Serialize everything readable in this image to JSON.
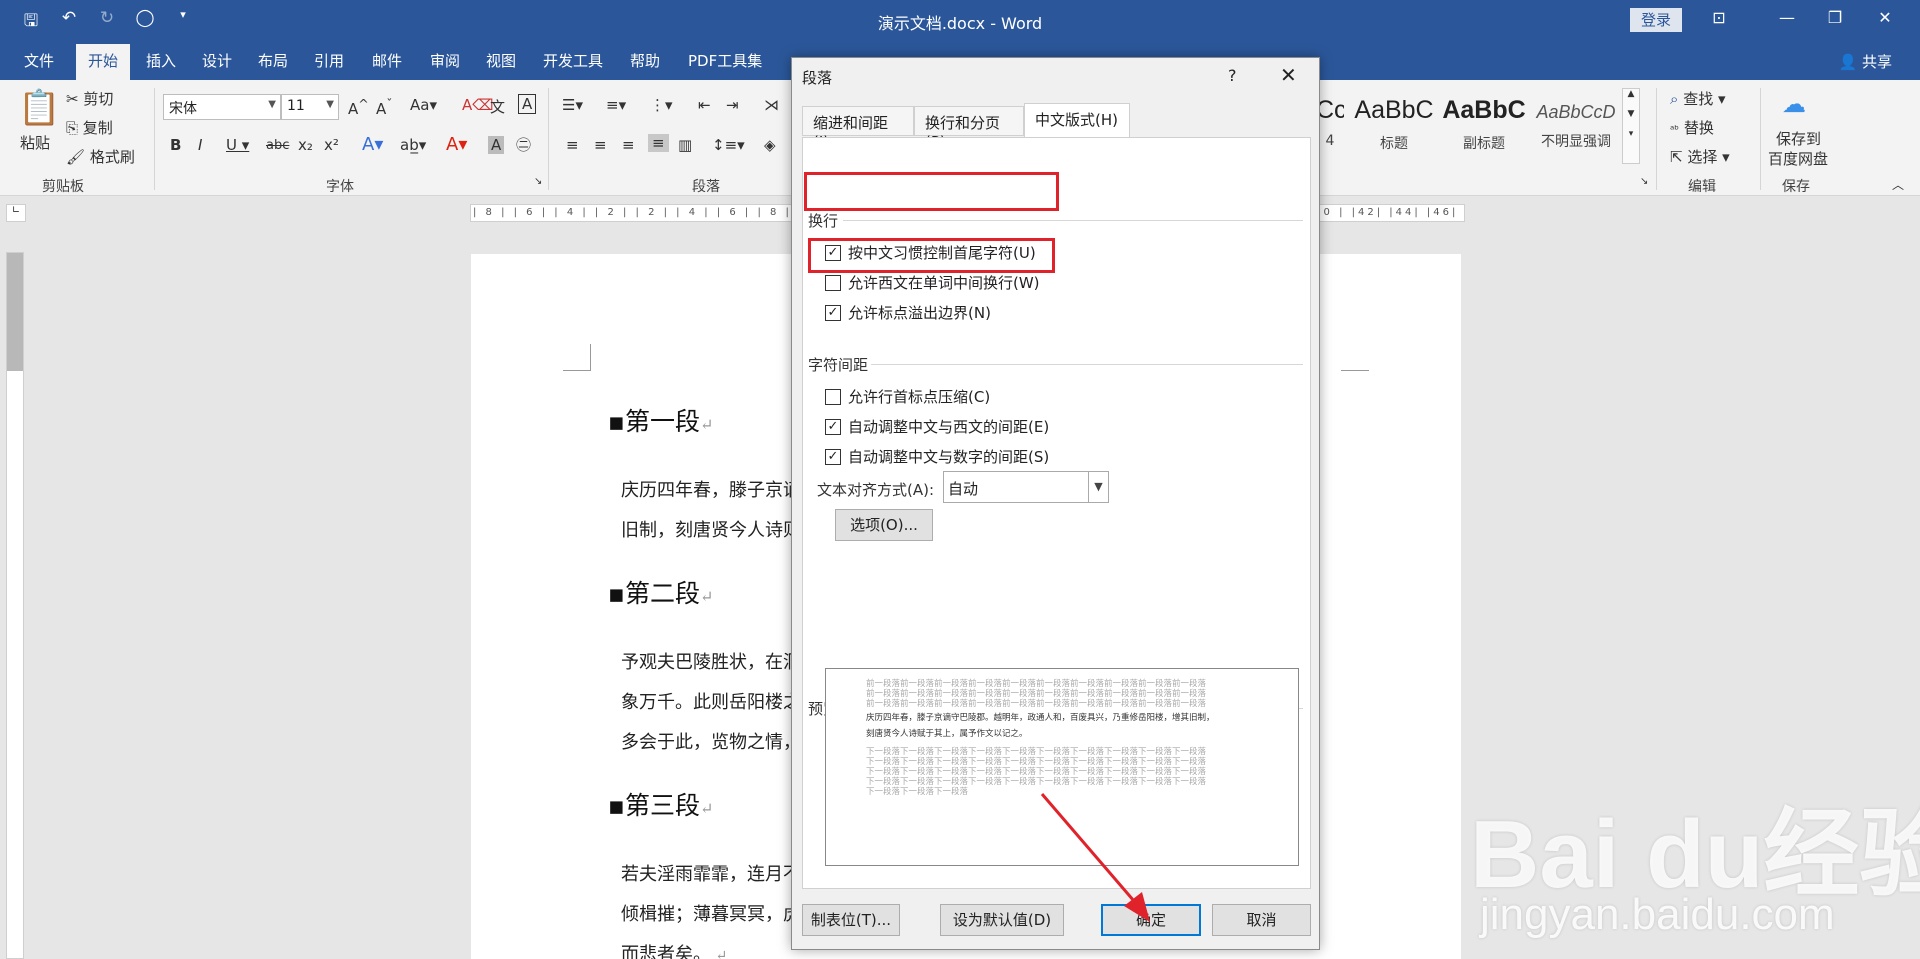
{
  "titlebar": {
    "doc_title": "演示文档.docx  -  Word",
    "login": "登录"
  },
  "tabs": [
    "文件",
    "开始",
    "插入",
    "设计",
    "布局",
    "引用",
    "邮件",
    "审阅",
    "视图",
    "开发工具",
    "帮助",
    "PDF工具集"
  ],
  "share": "共享",
  "ribbon": {
    "clipboard": {
      "paste": "粘贴",
      "cut": "剪切",
      "copy": "复制",
      "format_painter": "格式刷",
      "label": "剪贴板"
    },
    "font": {
      "name": "宋体",
      "size": "11",
      "label": "字体"
    },
    "paragraph_label": "段落",
    "styles": [
      {
        "sample": "AaBbC",
        "name": "标题"
      },
      {
        "sample": "AaBbC",
        "name": "副标题"
      },
      {
        "sample": "AaBbCcD",
        "name": "不明显强调"
      }
    ],
    "editing": {
      "find": "查找",
      "replace": "替换",
      "select": "选择",
      "label": "编辑"
    },
    "save": {
      "line1": "保存到",
      "line2": "百度网盘",
      "label": "保存"
    }
  },
  "ruler": "| 8 |   | 6 |   | 4 |   | 2 |       | 2 |   | 4 |   | 6 |   | 8 |",
  "ruler_right": "| 0 |   |42|   |44|   |46|   |48",
  "document": {
    "h1": "第一段",
    "p1_line1": "庆历四年春，滕子京谪",
    "p1_line2": "旧制，刻唐贤今人诗则",
    "h2": "第二段",
    "p2_line1": "予观夫巴陵胜状，在洞",
    "p2_line2": "象万千。此则岳阳楼之",
    "p2_line3": "多会于此，览物之情，",
    "h3": "第三段",
    "p3_line1": "若夫淫雨霏霏，连月不",
    "p3_line2": "倾楫摧；薄暮冥冥，虎",
    "p3_line3": "而悲者矣。"
  },
  "dialog": {
    "title": "段落",
    "help": "?",
    "tabs": [
      "缩进和间距(I)",
      "换行和分页(P)",
      "中文版式(H)"
    ],
    "section_wrap": "换行",
    "wrap_options": [
      {
        "label": "按中文习惯控制首尾字符(U)",
        "checked": true
      },
      {
        "label": "允许西文在单词中间换行(W)",
        "checked": false
      },
      {
        "label": "允许标点溢出边界(N)",
        "checked": true
      }
    ],
    "section_spacing": "字符间距",
    "spacing_options": [
      {
        "label": "允许行首标点压缩(C)",
        "checked": false
      },
      {
        "label": "自动调整中文与西文的间距(E)",
        "checked": true
      },
      {
        "label": "自动调整中文与数字的间距(S)",
        "checked": true
      }
    ],
    "align_label": "文本对齐方式(A):",
    "align_value": "自动",
    "options_btn": "选项(O)...",
    "preview_label": "预览",
    "preview_prev": "前一段落前一段落前一段落前一段落前一段落前一段落前一段落前一段落前一段落前一段落",
    "preview_text1": "庆历四年春，滕子京谪守巴陵郡。越明年，政通人和，百废具兴，乃重修岳阳楼，增其旧制，",
    "preview_text2": "刻唐贤今人诗赋于其上，属予作文以记之。",
    "preview_next": "下一段落下一段落下一段落下一段落下一段落下一段落下一段落下一段落下一段落下一段落",
    "preview_next_last": "下一段落下一段落下一段落",
    "btn_tabs": "制表位(T)...",
    "btn_default": "设为默认值(D)",
    "btn_ok": "确定",
    "btn_cancel": "取消"
  },
  "watermark": {
    "logo": "Bai du经验",
    "url": "jingyan.baidu.com"
  },
  "colors": {
    "titlebar": "#2b579a",
    "highlight": "#e0222a",
    "accent_button": "#0078d7"
  }
}
